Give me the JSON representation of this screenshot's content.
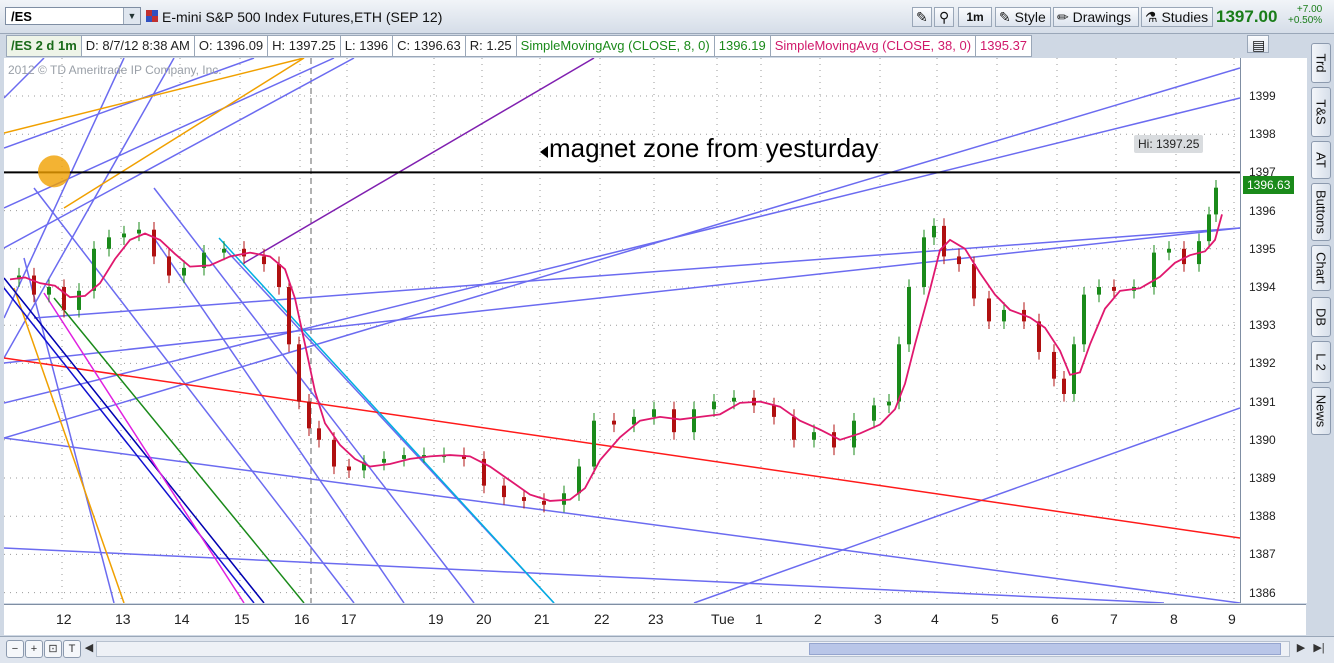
{
  "toolbar": {
    "symbol": "/ES",
    "instrument": "E-mini S&P 500 Index Futures,ETH (SEP 12)",
    "interval_btn": "1m",
    "style": "Style",
    "drawings": "Drawings",
    "studies": "Studies",
    "last_price": "1397.00",
    "change": "+7.00",
    "change_pct": "+0.50%"
  },
  "info": {
    "symbol_tf": "/ES 2 d 1m",
    "date": "D: 8/7/12 8:38 AM",
    "open": "O: 1396.09",
    "high": "H: 1397.25",
    "low": "L: 1396",
    "close": "C: 1396.63",
    "range": "R: 1.25",
    "sma_fast_label": "SimpleMovingAvg (CLOSE, 8, 0)",
    "sma_fast_value": "1396.19",
    "sma_slow_label": "SimpleMovingAvg (CLOSE, 38, 0)",
    "sma_slow_value": "1395.37"
  },
  "chart": {
    "copyright": "2012 © TD Ameritrade IP Company, Inc.",
    "annotation": "magnet zone from yesturday",
    "hi_label": "Hi: 1397.25",
    "current_price_tag": "1396.63",
    "yticks": [
      "1399",
      "1398",
      "1397",
      "1396",
      "1395",
      "1394",
      "1393",
      "1392",
      "1391",
      "1390",
      "1389",
      "1388",
      "1387",
      "1386"
    ],
    "xticks": [
      "12",
      "13",
      "14",
      "15",
      "16",
      "17",
      "19",
      "20",
      "21",
      "22",
      "23",
      "Tue",
      "1",
      "2",
      "3",
      "4",
      "5",
      "6",
      "7",
      "8",
      "9"
    ]
  },
  "right_tabs": [
    "Trd",
    "T&S",
    "AT",
    "Buttons",
    "Chart",
    "DB",
    "L 2",
    "News"
  ],
  "colors": {
    "up_bar": "#1a8a1a",
    "down_bar": "#b01010",
    "sma_fast": "#e0186e",
    "trend_lines": "#6b6bf0",
    "magnet_line": "#000000",
    "red_trend": "#ff1a1a"
  }
}
